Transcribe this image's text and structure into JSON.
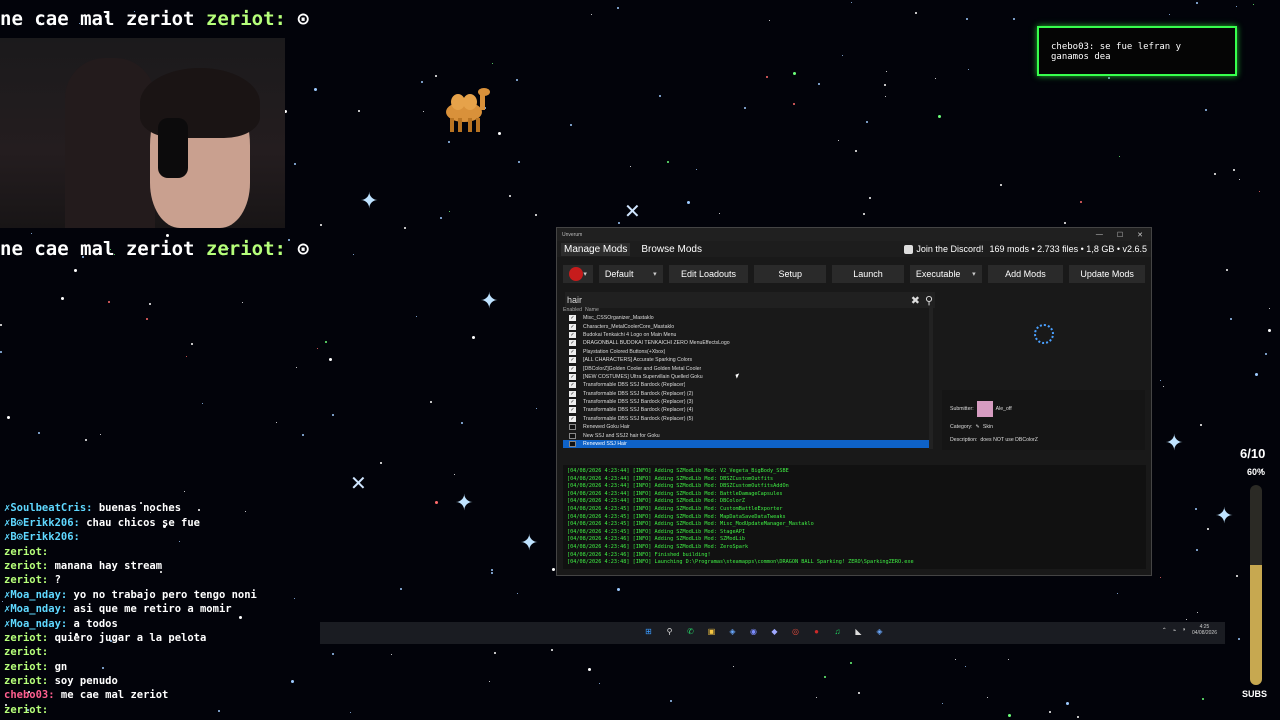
{
  "overlay": {
    "banner_top": {
      "text": "ne cae mal zeriot",
      "user": "zeriot:"
    },
    "banner_mid": {
      "text": "ne cae mal zeriot",
      "user": "zeriot:"
    },
    "chat": [
      {
        "user": "",
        "msg": "",
        "cls": "blue"
      },
      {
        "user": "✗SoulbeatCris:",
        "msg": "buenas noches",
        "cls": "blue"
      },
      {
        "user": "✗B⊙Erikk206:",
        "msg": "chau chicos se fue",
        "cls": "blue"
      },
      {
        "user": "✗B⊙Erikk206:",
        "msg": "",
        "cls": "blue"
      },
      {
        "user": "zeriot:",
        "msg": "",
        "cls": ""
      },
      {
        "user": "zeriot:",
        "msg": "manana hay stream",
        "cls": ""
      },
      {
        "user": "zeriot:",
        "msg": "?",
        "cls": ""
      },
      {
        "user": "✗Moa_nday:",
        "msg": "yo no trabajo pero tengo noni",
        "cls": "blue"
      },
      {
        "user": "✗Moa_nday:",
        "msg": "asi que me retiro a momir",
        "cls": "blue"
      },
      {
        "user": "✗Moa_nday:",
        "msg": "a todos",
        "cls": "blue"
      },
      {
        "user": "zeriot:",
        "msg": "quiero jugar a la pelota",
        "cls": ""
      },
      {
        "user": "zeriot:",
        "msg": "",
        "cls": ""
      },
      {
        "user": "zeriot:",
        "msg": "gn",
        "cls": ""
      },
      {
        "user": "zeriot:",
        "msg": "soy penudo",
        "cls": ""
      },
      {
        "user": "chebo03:",
        "msg": "me cae mal zeriot",
        "cls": "pink"
      },
      {
        "user": "zeriot:",
        "msg": "",
        "cls": ""
      }
    ],
    "notification": "chebo03: se fue lefran y ganamos dea",
    "sub_goal": {
      "count": "6/10",
      "percent": "60%",
      "fill": 0.6,
      "label": "SUBS"
    }
  },
  "app": {
    "title": "Unverum",
    "tabs": [
      {
        "label": "Manage Mods"
      },
      {
        "label": "Browse Mods"
      }
    ],
    "discord": "Join the Discord!",
    "stats": "169 mods • 2.733 files • 1,8 GB • v2.6.5",
    "toolbar": {
      "loadout": "Default",
      "edit_loadouts": "Edit Loadouts",
      "setup": "Setup",
      "launch": "Launch",
      "executable": "Executable",
      "add_mods": "Add Mods",
      "update_mods": "Update Mods"
    },
    "search_value": "hair",
    "columns": {
      "enabled": "Enabled",
      "name": "Name"
    },
    "mods": [
      {
        "name": "Misc_CSSOrganizer_Mastaklo",
        "checked": true
      },
      {
        "name": "Characters_MetalCoolerCore_Mastaklo",
        "checked": true
      },
      {
        "name": "Budokai Tenkaichi 4 Logo on Main Menu",
        "checked": true
      },
      {
        "name": "DRAGONBALL BUDOKAI TENKAICHI ZERO MenuEffectsLogo",
        "checked": true
      },
      {
        "name": "Playstation Colored Buttons(+Xbox)",
        "checked": true
      },
      {
        "name": "[ALL CHARACTERS] Accurate Sparking Colors",
        "checked": true
      },
      {
        "name": "[DBColorZ]Golden Cooler and Golden Metal Cooler",
        "checked": true
      },
      {
        "name": "[NEW COSTUMES] Ultra Supervillain Quelled Goku",
        "checked": true
      },
      {
        "name": "Transformable DBS SSJ Bardock (Replacer)",
        "checked": true
      },
      {
        "name": "Transformable DBS SSJ Bardock (Replacer) (2)",
        "checked": true
      },
      {
        "name": "Transformable DBS SSJ Bardock (Replacer) (3)",
        "checked": true
      },
      {
        "name": "Transformable DBS SSJ Bardock (Replacer) (4)",
        "checked": true
      },
      {
        "name": "Transformable DBS SSJ Bardock (Replacer) (5)",
        "checked": true
      },
      {
        "name": "Renewed Goku Hair",
        "checked": false
      },
      {
        "name": "New SSJ and SSJ2 hair for Goku",
        "checked": false
      },
      {
        "name": "Renewed SSJ Hair",
        "checked": false,
        "selected": true
      }
    ],
    "details": {
      "submitter_label": "Submitter:",
      "submitter": "Ale_off",
      "category_label": "Category:",
      "category": "Skin",
      "description_label": "Description:",
      "description": "does NOT use DBColorZ"
    },
    "log": [
      "[04/08/2026 4:23:44] [INFO] Adding SZModLib Mod: V2_Vegeta_BigBody_SSBE",
      "[04/08/2026 4:23:44] [INFO] Adding SZModLib Mod: DBSZCustomOutfits",
      "[04/08/2026 4:23:44] [INFO] Adding SZModLib Mod: DBSZCustomOutfitsAddOn",
      "[04/08/2026 4:23:44] [INFO] Adding SZModLib Mod: BattleDamageCapsules",
      "[04/08/2026 4:23:44] [INFO] Adding SZModLib Mod: DBColorZ",
      "[04/08/2026 4:23:45] [INFO] Adding SZModLib Mod: CustomBattleExporter",
      "[04/08/2026 4:23:45] [INFO] Adding SZModLib Mod: MapDataSaveDataTweaks",
      "[04/08/2026 4:23:45] [INFO] Adding SZModLib Mod: Misc_ModUpdateManager_Mastaklo",
      "[04/08/2026 4:23:45] [INFO] Adding SZModLib Mod: StageAPI",
      "[04/08/2026 4:23:46] [INFO] Adding SZModLib Mod: SZModLib",
      "[04/08/2026 4:23:46] [INFO] Adding SZModLib Mod: ZeroSpark",
      "[04/08/2026 4:23:46] [INFO] Finished building!",
      "[04/08/2026 4:23:48] [INFO] Launching D:\\Programas\\steamapps\\common\\DRAGON BALL Sparking! ZERO\\SparkingZERO.exe"
    ]
  },
  "taskbar": {
    "icons": [
      "windows-icon",
      "search-icon",
      "whatsapp-icon",
      "folder-icon",
      "steam-icon",
      "discord-icon",
      "app-icon",
      "chrome-icon",
      "obs-icon",
      "spotify-icon",
      "unverum-icon",
      "steam2-icon"
    ],
    "time": "4:25",
    "date": "04/08/2026"
  }
}
